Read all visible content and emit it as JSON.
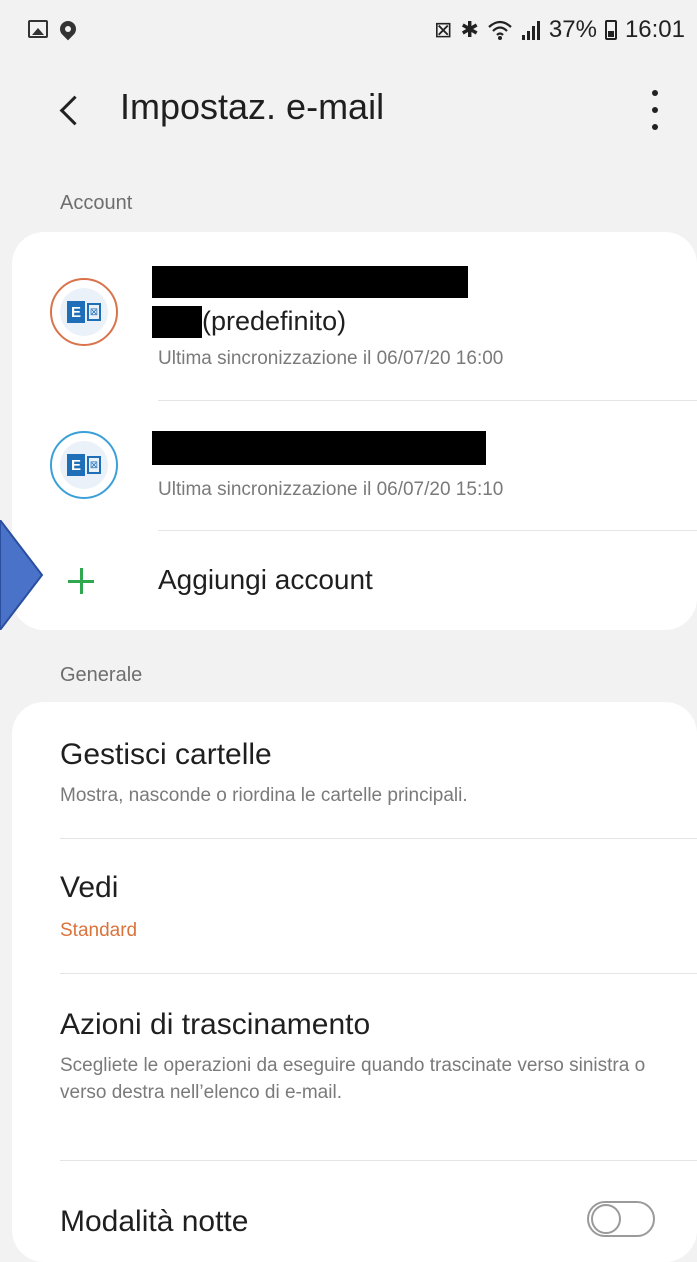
{
  "status_bar": {
    "icons_left": [
      "gallery-icon",
      "location-pin-icon"
    ],
    "icons_right": [
      "battery-saver-icon",
      "bluetooth-icon",
      "wifi-icon",
      "signal-icon"
    ],
    "battery": "37%",
    "time": "16:01"
  },
  "app_bar": {
    "title": "Impostaz. e-mail",
    "back_icon": "chevron-left-icon",
    "more_icon": "more-vert-icon"
  },
  "accounts_section": {
    "label": "Account",
    "accounts": [
      {
        "icon": "exchange-icon",
        "name_suffix": "(predefinito)",
        "sync": "Ultima sincronizzazione il 06/07/20  16:00",
        "ring_color": "#d9734a"
      },
      {
        "icon": "exchange-icon",
        "name_suffix": "",
        "sync": "Ultima sincronizzazione il 06/07/20  15:10",
        "ring_color": "#3aa0d8"
      }
    ],
    "add_label": "Aggiungi account",
    "add_icon_color": "#2fa84f"
  },
  "general_section": {
    "label": "Generale",
    "items": [
      {
        "title": "Gestisci cartelle",
        "subtitle": "Mostra, nasconde o riordina le cartelle principali."
      },
      {
        "title": "Vedi",
        "subtitle": "Standard"
      },
      {
        "title": "Azioni di trascinamento",
        "subtitle": "Scegliete le operazioni da eseguire quando trascinate verso sinistra o verso destra nell’elenco di e-mail."
      },
      {
        "title": "Modalità notte",
        "toggle": false
      }
    ]
  },
  "colors": {
    "background": "#f2f2f2",
    "card": "#ffffff",
    "accent_orange": "#d9733c",
    "annotation_arrow": "#4a72c9"
  }
}
